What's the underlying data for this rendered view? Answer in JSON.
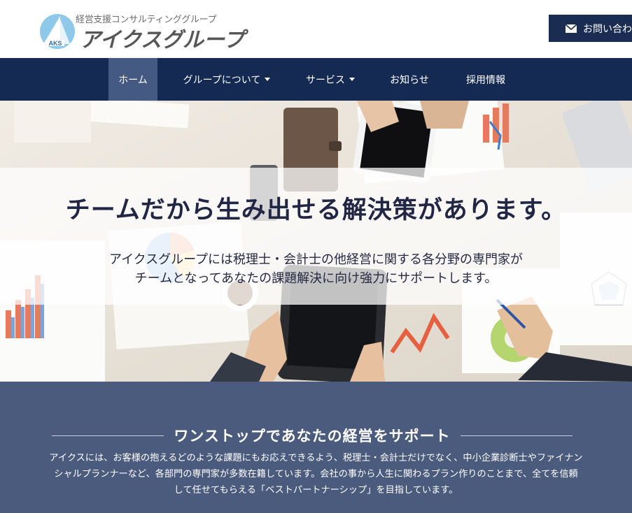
{
  "header": {
    "tagline": "経営支援コンサルティンググループ",
    "company_name": "アイクスグループ",
    "logo_mark_text": "AKS",
    "contact_label": "お問い合わせ",
    "contact_icon": "mail-icon"
  },
  "nav": {
    "items": [
      {
        "label": "ホーム",
        "active": true,
        "has_dropdown": false
      },
      {
        "label": "グループについて",
        "active": false,
        "has_dropdown": true
      },
      {
        "label": "サービス",
        "active": false,
        "has_dropdown": true
      },
      {
        "label": "お知らせ",
        "active": false,
        "has_dropdown": false
      },
      {
        "label": "採用情報",
        "active": false,
        "has_dropdown": false
      }
    ]
  },
  "hero": {
    "headline": "チームだから生み出せる解決策があります。",
    "subtext_lines": [
      "アイクスグループには税理士・会計士の他経営に関する各分野の専門家が",
      "チームとなってあなたの課題解決に向け強力にサポートします。"
    ]
  },
  "support": {
    "title": "ワンストップであなたの経営をサポート",
    "text_lines": [
      "アイクスには、お客様の抱えるどのような課題にもお応えできるよう、税理士・会計士だけでなく、中小企業診断士やファイナン",
      "シャルプランナーなど、各部門の専門家が多数在籍しています。会社の事から人生に関わるプラン作りのことまで、全てを信頼",
      "して任せてもらえる「ベストパートナーシップ」を目指しています。"
    ]
  },
  "colors": {
    "header_bg": "#ffffff",
    "nav_bg": "#152a53",
    "nav_active_bg": "#455a83",
    "contact_bg": "#1a2c52",
    "support_bg": "#4b5b7e",
    "headline_color": "#222645"
  }
}
